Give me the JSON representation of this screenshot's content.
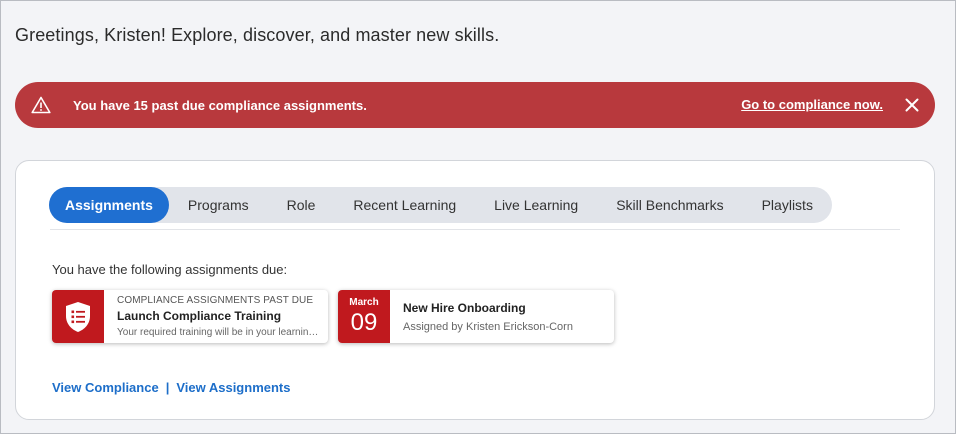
{
  "greeting": "Greetings, Kristen! Explore, discover, and master new skills.",
  "alert": {
    "message": "You have 15 past due compliance assignments.",
    "link": "Go to compliance now.",
    "icon": "warning-icon",
    "color": "#b8393d"
  },
  "tabs": [
    {
      "label": "Assignments",
      "active": true
    },
    {
      "label": "Programs"
    },
    {
      "label": "Role"
    },
    {
      "label": "Recent Learning"
    },
    {
      "label": "Live Learning"
    },
    {
      "label": "Skill Benchmarks"
    },
    {
      "label": "Playlists"
    }
  ],
  "due_label": "You have the following assignments due:",
  "assignments": [
    {
      "kicker": "COMPLIANCE ASSIGNMENTS PAST DUE",
      "title": "Launch Compliance Training",
      "desc": "Your required training will be in your learning pl...",
      "icon": "compliance-shield-icon"
    },
    {
      "month": "March",
      "day": "09",
      "title": "New Hire Onboarding",
      "desc": "Assigned by Kristen Erickson-Corn"
    }
  ],
  "links": {
    "view_compliance": "View Compliance",
    "separator": "|",
    "view_assignments": "View Assignments"
  },
  "colors": {
    "accent": "#1f6fd1",
    "badge": "#c0191e"
  }
}
